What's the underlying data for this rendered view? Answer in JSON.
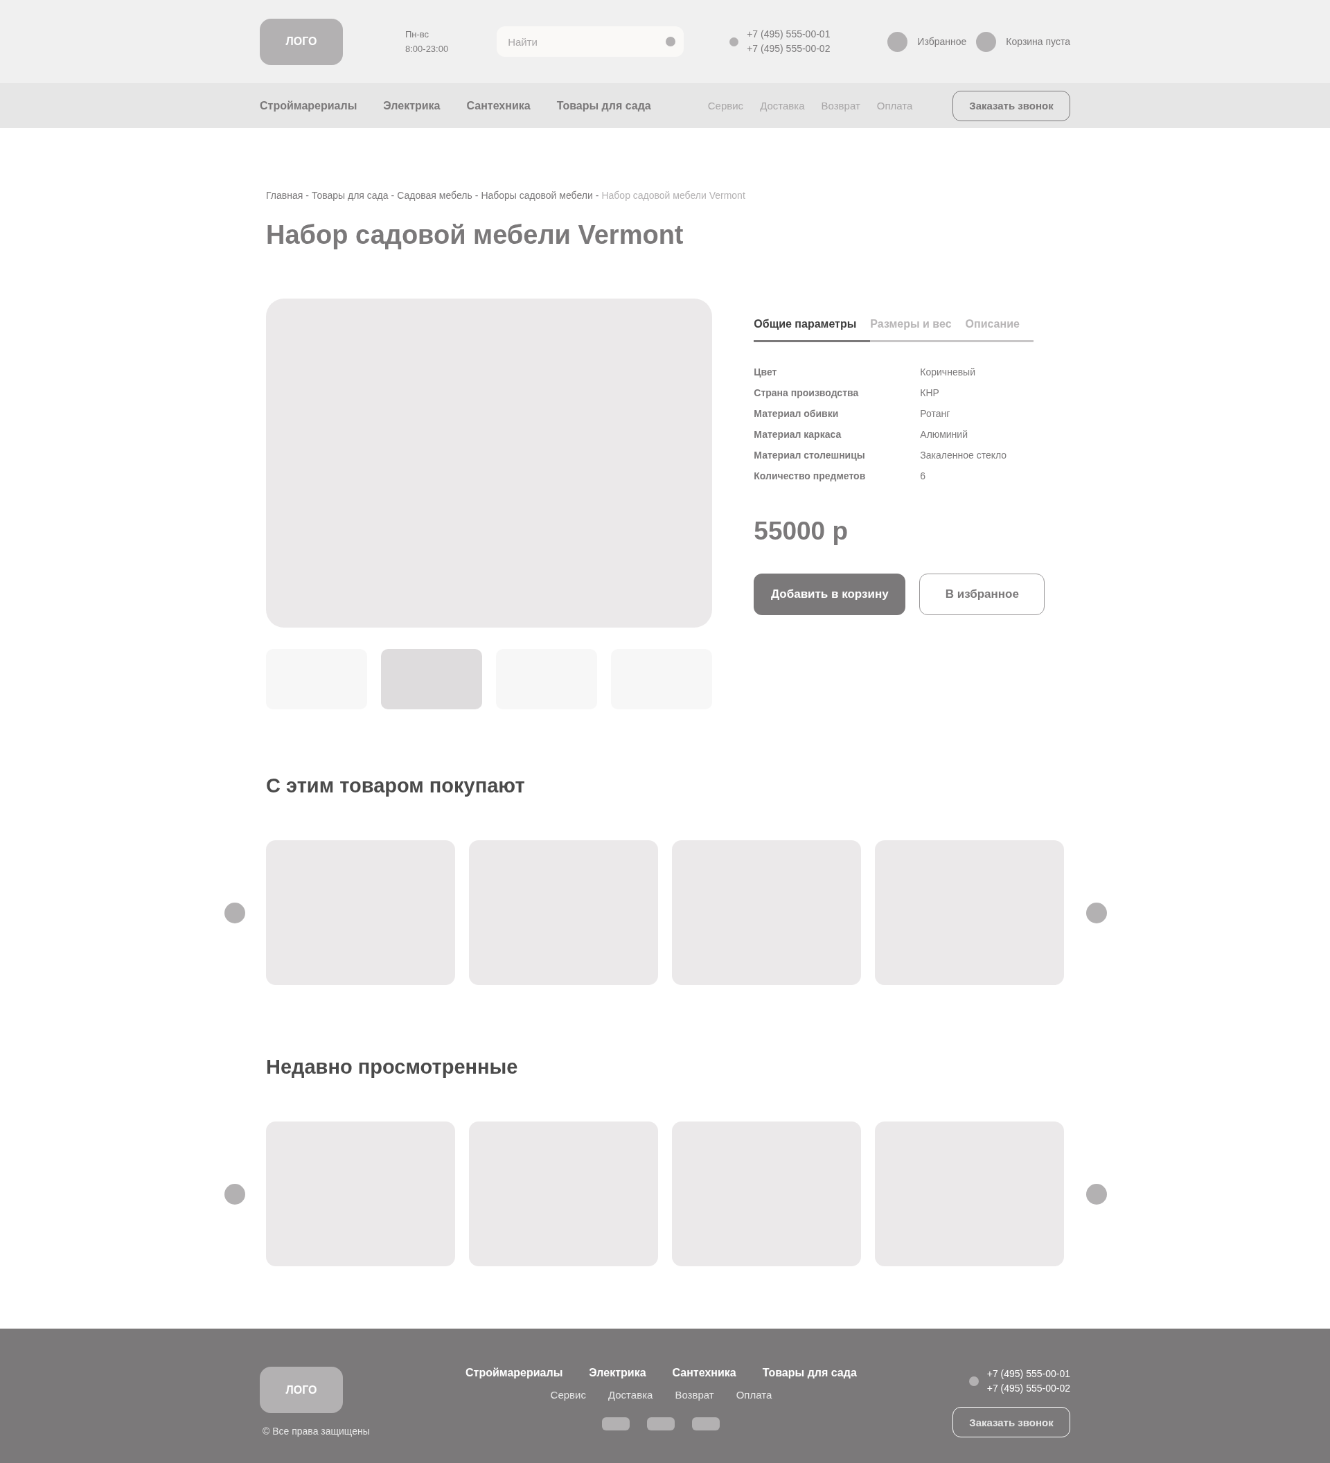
{
  "header": {
    "logo": "ЛОГО",
    "hours": [
      "Пн-вс",
      "8:00-23:00"
    ],
    "search": {
      "placeholder": "Найти"
    },
    "phones": [
      "+7 (495) 555-00-01",
      "+7 (495) 555-00-02"
    ],
    "favorites": "Избранное",
    "cart": "Корзина пуста"
  },
  "nav": {
    "categories": [
      "Строймарериалы",
      "Электрика",
      "Сантехника",
      "Товары для сада"
    ],
    "links": [
      "Сервис",
      "Доставка",
      "Возврат",
      "Оплата"
    ],
    "callback": "Заказать звонок"
  },
  "breadcrumb_separator": "-",
  "breadcrumbs": [
    {
      "label": "Главная",
      "current": false
    },
    {
      "label": "Товары для сада",
      "current": false
    },
    {
      "label": "Садовая мебель",
      "current": false
    },
    {
      "label": "Наборы садовой мебели",
      "current": false
    },
    {
      "label": "Набор садовой мебели Vermont",
      "current": true
    }
  ],
  "title": "Набор садовой мебели Vermont",
  "gallery": {
    "thumbnails": [
      {
        "selected": false
      },
      {
        "selected": true
      },
      {
        "selected": false
      },
      {
        "selected": false
      }
    ]
  },
  "tabs": [
    {
      "label": "Общие параметры",
      "selected": true
    },
    {
      "label": "Размеры и вес",
      "selected": false
    },
    {
      "label": "Описание",
      "selected": false
    }
  ],
  "specs": [
    {
      "name": "Цвет",
      "value": "Коричневый"
    },
    {
      "name": "Страна производства",
      "value": "КНР"
    },
    {
      "name": "Материал обивки",
      "value": "Ротанг"
    },
    {
      "name": "Материал каркаса",
      "value": "Алюминий"
    },
    {
      "name": "Материал столешницы",
      "value": "Закаленное стекло"
    },
    {
      "name": "Количество предметов",
      "value": "6"
    }
  ],
  "price": "55000 р",
  "buttons": {
    "add_to_cart": "Добавить в корзину",
    "favorite": "В избранное"
  },
  "sections": [
    {
      "title": "С этим товаром покупают"
    },
    {
      "title": "Недавно просмотренные"
    }
  ],
  "footer": {
    "logo": "ЛОГО",
    "copyright": "© Все права защищены",
    "categories": [
      "Строймарериалы",
      "Электрика",
      "Сантехника",
      "Товары для сада"
    ],
    "links": [
      "Сервис",
      "Доставка",
      "Возврат",
      "Оплата"
    ],
    "phones": [
      "+7 (495) 555-00-01",
      "+7 (495) 555-00-02"
    ],
    "callback": "Заказать звонок"
  }
}
